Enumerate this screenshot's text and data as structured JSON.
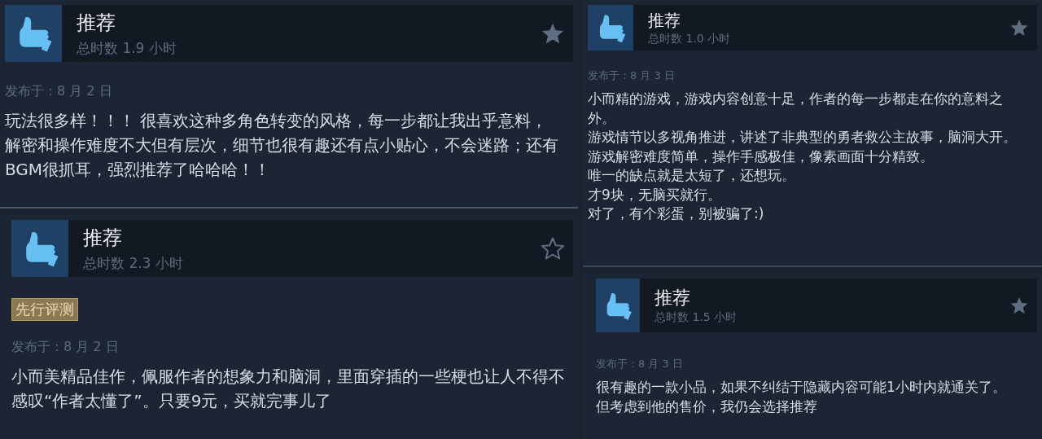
{
  "columns": [
    {
      "reviews": [
        {
          "verdict": "推荐",
          "hours": "总时数 1.9 小时",
          "star_filled": true,
          "posted": "发布于：8 月 2 日",
          "paragraphs": [
            "玩法很多样！！！ 很喜欢这种多角色转变的风格，每一步都让我出乎意料，解密和操作难度不大但有层次，细节也很有趣还有点小贴心，不会迷路；还有BGM很抓耳，强烈推荐了哈哈哈！！"
          ]
        },
        {
          "verdict": "推荐",
          "hours": "总时数 2.3 小时",
          "star_filled": false,
          "badge": "先行评测",
          "posted": "发布于：8 月 2 日",
          "paragraphs": [
            "小而美精品佳作，佩服作者的想象力和脑洞，里面穿插的一些梗也让人不得不感叹“作者太懂了”。只要9元，买就完事儿了"
          ]
        }
      ]
    },
    {
      "reviews": [
        {
          "verdict": "推荐",
          "hours": "总时数 1.0 小时",
          "star_filled": true,
          "posted": "发布于：8 月 3 日",
          "paragraphs": [
            "小而精的游戏，游戏内容创意十足，作者的每一步都走在你的意料之外。",
            "游戏情节以多视角推进，讲述了非典型的勇者救公主故事，脑洞大开。",
            "游戏解密难度简单，操作手感极佳，像素画面十分精致。",
            "唯一的缺点就是太短了，还想玩。",
            "才9块，无脑买就行。",
            "对了，有个彩蛋，别被骗了:)"
          ]
        },
        {
          "verdict": "推荐",
          "hours": "总时数 1.5 小时",
          "star_filled": true,
          "posted": "发布于：8 月 3 日",
          "paragraphs": [
            "很有趣的一款小品，如果不纠结于隐藏内容可能1小时内就通关了。",
            "但考虑到他的售价，我仍会选择推荐"
          ]
        }
      ]
    }
  ]
}
